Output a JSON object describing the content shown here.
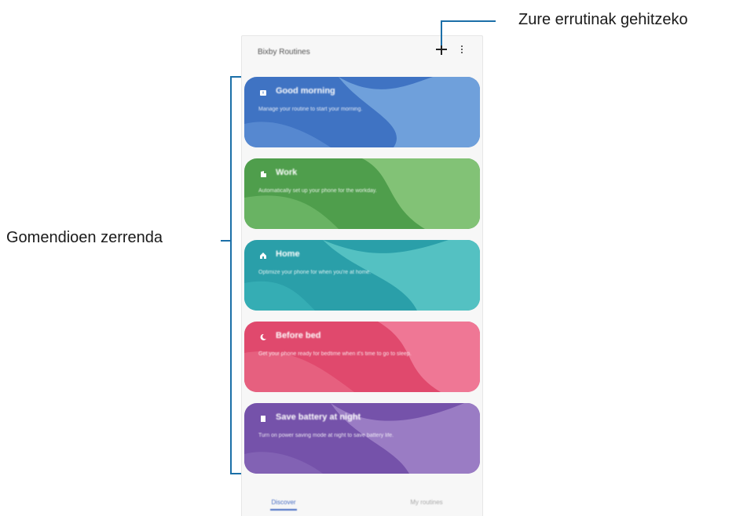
{
  "annotations": {
    "add_routines": "Zure errutinak gehitzeko",
    "recommended_list": "Gomendioen zerrenda"
  },
  "app": {
    "title": "Bixby Routines",
    "add_icon": "plus-icon",
    "more_icon": "more-vert-icon"
  },
  "routines": [
    {
      "title": "Good morning",
      "description": "Manage your routine to start your morning.",
      "icon": "alarm-icon",
      "colors": [
        "#3f73c3",
        "#6fa0db",
        "#5688d0"
      ]
    },
    {
      "title": "Work",
      "description": "Automatically set up your phone for the workday.",
      "icon": "work-icon",
      "colors": [
        "#4f9e4c",
        "#82c276",
        "#69b363"
      ]
    },
    {
      "title": "Home",
      "description": "Optimize your phone for when you're at home.",
      "icon": "home-icon",
      "colors": [
        "#2a9fa9",
        "#54c1c2",
        "#35adb4"
      ]
    },
    {
      "title": "Before bed",
      "description": "Get your phone ready for bedtime when it's time to go to sleep.",
      "icon": "moon-icon",
      "colors": [
        "#e0496d",
        "#ef7795",
        "#e6607f"
      ]
    },
    {
      "title": "Save battery at night",
      "description": "Turn on power saving mode at night to save battery life.",
      "icon": "battery-icon",
      "colors": [
        "#7552aa",
        "#9a7cc4",
        "#8262b4"
      ]
    }
  ],
  "tabs": {
    "discover": "Discover",
    "my_routines": "My routines"
  }
}
